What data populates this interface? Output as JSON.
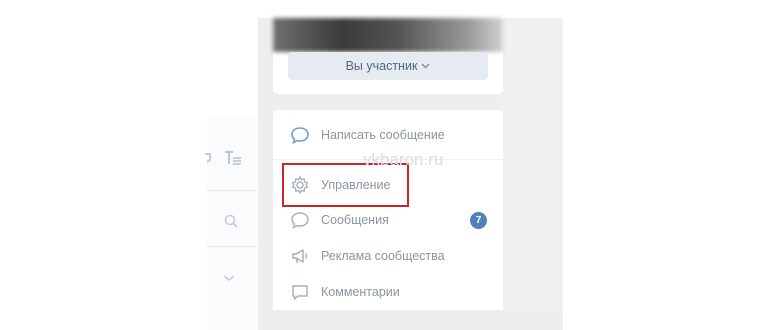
{
  "colors": {
    "accent": "#5181b8",
    "highlight_border": "#c9262b",
    "menu_text": "#8b95a1",
    "icon": "#a5b2c2"
  },
  "header": {
    "member_button_label": "Вы участник",
    "member_button_icon": "chevron-down-icon"
  },
  "watermark": "vkbaron.ru",
  "left_panel": {
    "icons": [
      "text-format-icon",
      "search-icon",
      "chevron-down-icon"
    ]
  },
  "menu": {
    "items": [
      {
        "label": "Написать сообщение",
        "icon": "speech-bubble-icon"
      },
      {
        "label": "Управление",
        "icon": "gear-icon",
        "highlighted": true
      },
      {
        "label": "Сообщения",
        "icon": "speech-bubble-icon",
        "badge": "7"
      },
      {
        "label": "Реклама сообщества",
        "icon": "megaphone-icon"
      },
      {
        "label": "Комментарии",
        "icon": "comment-icon"
      }
    ]
  }
}
